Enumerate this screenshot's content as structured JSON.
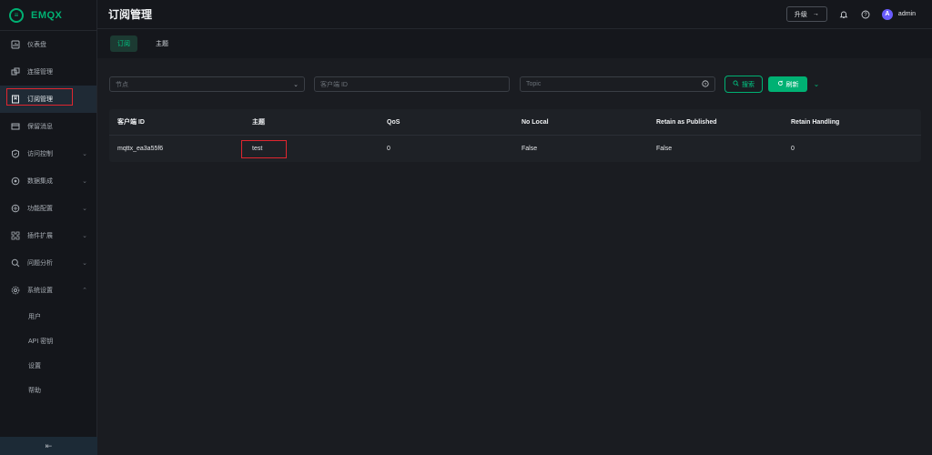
{
  "brand": {
    "name": "EMQX",
    "accent": "#00b173"
  },
  "sidebar": {
    "items": [
      {
        "label": "仪表盘",
        "icon": "dashboard-icon",
        "has_children": false
      },
      {
        "label": "连接管理",
        "icon": "connections-icon",
        "has_children": false
      },
      {
        "label": "订阅管理",
        "icon": "subscriptions-icon",
        "has_children": false,
        "active": true
      },
      {
        "label": "保留消息",
        "icon": "retained-icon",
        "has_children": false
      },
      {
        "label": "访问控制",
        "icon": "shield-icon",
        "has_children": true
      },
      {
        "label": "数据集成",
        "icon": "integration-icon",
        "has_children": true
      },
      {
        "label": "功能配置",
        "icon": "config-icon",
        "has_children": true
      },
      {
        "label": "插件扩展",
        "icon": "plugin-icon",
        "has_children": true
      },
      {
        "label": "问题分析",
        "icon": "diagnose-icon",
        "has_children": true
      },
      {
        "label": "系统设置",
        "icon": "settings-icon",
        "has_children": true,
        "expanded": true
      }
    ],
    "sub_items": [
      "用户",
      "API 密钥",
      "设置",
      "帮助"
    ],
    "collapse_glyph": "⇤"
  },
  "header": {
    "title": "订阅管理",
    "upgrade_label": "升级",
    "user": "admin",
    "avatar_letter": "A"
  },
  "tabs": [
    {
      "label": "订阅",
      "active": true
    },
    {
      "label": "主题",
      "active": false
    }
  ],
  "filters": {
    "node_placeholder": "节点",
    "client_placeholder": "客户端 ID",
    "topic_placeholder": "Topic",
    "search_label": "搜索",
    "refresh_label": "刷新"
  },
  "table": {
    "columns": [
      "客户端 ID",
      "主题",
      "QoS",
      "No Local",
      "Retain as Published",
      "Retain Handling"
    ],
    "rows": [
      [
        "mqttx_ea3a55f6",
        "test",
        "0",
        "False",
        "False",
        "0"
      ]
    ]
  }
}
